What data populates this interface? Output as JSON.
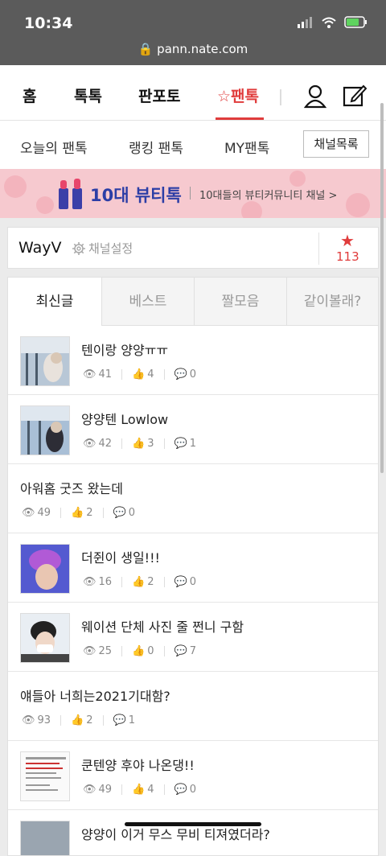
{
  "status": {
    "time": "10:34",
    "url": "pann.nate.com"
  },
  "topnav": {
    "home": "홈",
    "toktok": "톡톡",
    "panpoto": "판포토",
    "fantok": "팬톡"
  },
  "subnav": {
    "today": "오늘의 팬톡",
    "ranking": "랭킹 팬톡",
    "my": "MY팬톡",
    "channel_list": "채널목록"
  },
  "banner": {
    "title": "10대 뷰티톡",
    "subtitle": "10대들의 뷰티커뮤니티 채널 >"
  },
  "channel": {
    "name": "WayV",
    "setting": "채널설정",
    "star_count": "113"
  },
  "tabs": [
    "최신글",
    "베스트",
    "짤모음",
    "같이볼래?"
  ],
  "posts": [
    {
      "title": "텐이랑 양양ㅠㅠ",
      "views": "41",
      "likes": "4",
      "comments": "0"
    },
    {
      "title": "양양텐 Lowlow",
      "views": "42",
      "likes": "3",
      "comments": "1"
    },
    {
      "title": "아워홈 굿즈 왔는데",
      "views": "49",
      "likes": "2",
      "comments": "0"
    },
    {
      "title": "더쥔이 생일!!!",
      "views": "16",
      "likes": "2",
      "comments": "0"
    },
    {
      "title": "웨이션 단체 사진 줄 쩐니 구함",
      "views": "25",
      "likes": "0",
      "comments": "7"
    },
    {
      "title": "얘들아 너희는2021기대함?",
      "views": "93",
      "likes": "2",
      "comments": "1"
    },
    {
      "title": "쿤텐양 후야 나온댕!!",
      "views": "49",
      "likes": "4",
      "comments": "0"
    },
    {
      "title": "양양이 이거 무스 무비 티져였더라?"
    }
  ],
  "colors": {
    "accent": "#e03c3c",
    "banner_bg": "#f6c9cf",
    "banner_title": "#2c3ea6"
  }
}
